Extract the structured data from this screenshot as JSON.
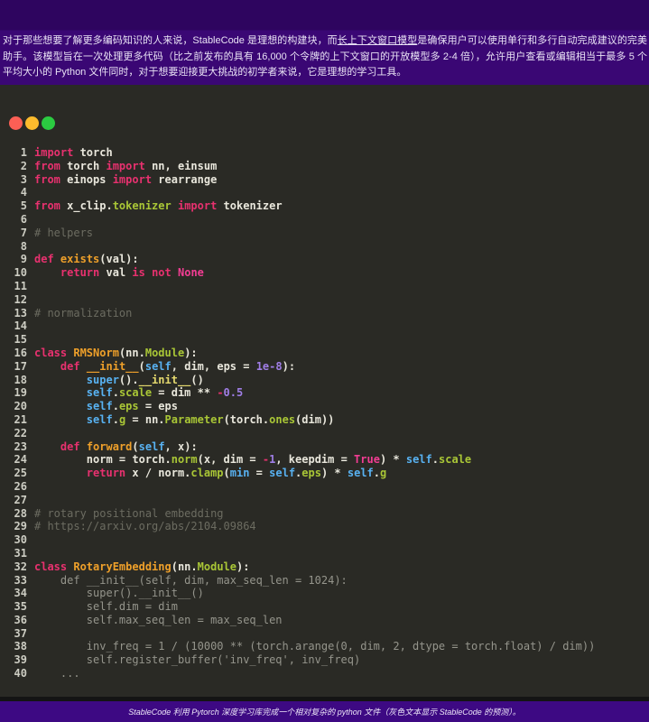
{
  "header": {
    "paragraph_before_link": "对于那些想要了解更多编码知识的人来说，StableCode 是理想的构建块，而",
    "link_text": "长上下文窗口模型",
    "paragraph_after_link": "是确保用户可以使用单行和多行自动完成建议的完美助手。该模型旨在一次处理更多代码（比之前发布的具有 16,000 个令牌的上下文窗口的开放模型多 2-4 倍），允许用户查看或编辑相当于最多 5 个平均大小的 Python 文件同时，对于想要迎接更大挑战的初学者来说，它是理想的学习工具。"
  },
  "window": {
    "traffic_lights": [
      {
        "name": "close-button",
        "color": "#fb5f55"
      },
      {
        "name": "minimize-button",
        "color": "#fcbb2d"
      },
      {
        "name": "zoom-button",
        "color": "#2bcb41"
      }
    ]
  },
  "colors": {
    "banner_purple": "#3a0774",
    "footer_purple": "#3d0983",
    "code_background": "#2a2a25",
    "keyword_pink": "#e8316f",
    "constant_magenta": "#f23d93",
    "function_orange": "#efa02a",
    "method_green": "#a9c636",
    "builtin_blue": "#58b2f2",
    "number_purple": "#a07ee6",
    "comment_gray": "#6c6c61",
    "prediction_gray": "#95958c",
    "plain_code": "#e9e7dc"
  },
  "code": {
    "lines": [
      {
        "num": "1",
        "tk": [
          [
            "k",
            "import"
          ],
          [
            "p",
            " torch"
          ]
        ]
      },
      {
        "num": "2",
        "tk": [
          [
            "k",
            "from"
          ],
          [
            "p",
            " torch "
          ],
          [
            "k",
            "import"
          ],
          [
            "p",
            " nn, einsum"
          ]
        ]
      },
      {
        "num": "3",
        "tk": [
          [
            "k",
            "from"
          ],
          [
            "p",
            " einops "
          ],
          [
            "k",
            "import"
          ],
          [
            "p",
            " rearrange"
          ]
        ]
      },
      {
        "num": "4",
        "tk": []
      },
      {
        "num": "5",
        "tk": [
          [
            "k",
            "from"
          ],
          [
            "p",
            " x_clip."
          ],
          [
            "g",
            "tokenizer"
          ],
          [
            "p",
            " "
          ],
          [
            "k",
            "import"
          ],
          [
            "p",
            " tokenizer"
          ]
        ]
      },
      {
        "num": "6",
        "tk": []
      },
      {
        "num": "7",
        "tk": [
          [
            "c",
            "# helpers"
          ]
        ]
      },
      {
        "num": "8",
        "tk": []
      },
      {
        "num": "9",
        "tk": [
          [
            "k",
            "def"
          ],
          [
            "p",
            " "
          ],
          [
            "f",
            "exists"
          ],
          [
            "p",
            "(val):"
          ]
        ]
      },
      {
        "num": "10",
        "tk": [
          [
            "p",
            "    "
          ],
          [
            "k",
            "return"
          ],
          [
            "p",
            " val "
          ],
          [
            "k",
            "is"
          ],
          [
            "p",
            " "
          ],
          [
            "k",
            "not"
          ],
          [
            "p",
            " "
          ],
          [
            "K",
            "None"
          ]
        ]
      },
      {
        "num": "11",
        "tk": []
      },
      {
        "num": "12",
        "tk": []
      },
      {
        "num": "13",
        "tk": [
          [
            "c",
            "# normalization"
          ]
        ]
      },
      {
        "num": "14",
        "tk": []
      },
      {
        "num": "15",
        "tk": []
      },
      {
        "num": "16",
        "tk": [
          [
            "k",
            "class"
          ],
          [
            "p",
            " "
          ],
          [
            "f",
            "RMSNorm"
          ],
          [
            "p",
            "(nn."
          ],
          [
            "g",
            "Module"
          ],
          [
            "p",
            "):"
          ]
        ]
      },
      {
        "num": "17",
        "tk": [
          [
            "p",
            "    "
          ],
          [
            "k",
            "def"
          ],
          [
            "p",
            " "
          ],
          [
            "f",
            "__init__"
          ],
          [
            "p",
            "("
          ],
          [
            "b",
            "self"
          ],
          [
            "p",
            ", dim, eps = "
          ],
          [
            "n",
            "1e-8"
          ],
          [
            "p",
            "):"
          ]
        ]
      },
      {
        "num": "18",
        "tk": [
          [
            "p",
            "        "
          ],
          [
            "b",
            "super"
          ],
          [
            "p",
            "()."
          ],
          [
            "y",
            "__init__"
          ],
          [
            "p",
            "()"
          ]
        ]
      },
      {
        "num": "19",
        "tk": [
          [
            "p",
            "        "
          ],
          [
            "b",
            "self"
          ],
          [
            "p",
            "."
          ],
          [
            "g",
            "scale"
          ],
          [
            "p",
            " = dim ** "
          ],
          [
            "o",
            "-"
          ],
          [
            "n",
            "0.5"
          ]
        ]
      },
      {
        "num": "20",
        "tk": [
          [
            "p",
            "        "
          ],
          [
            "b",
            "self"
          ],
          [
            "p",
            "."
          ],
          [
            "g",
            "eps"
          ],
          [
            "p",
            " = eps"
          ]
        ]
      },
      {
        "num": "21",
        "tk": [
          [
            "p",
            "        "
          ],
          [
            "b",
            "self"
          ],
          [
            "p",
            "."
          ],
          [
            "g",
            "g"
          ],
          [
            "p",
            " = nn."
          ],
          [
            "g",
            "Parameter"
          ],
          [
            "p",
            "(torch."
          ],
          [
            "g",
            "ones"
          ],
          [
            "p",
            "(dim))"
          ]
        ]
      },
      {
        "num": "22",
        "tk": []
      },
      {
        "num": "23",
        "tk": [
          [
            "p",
            "    "
          ],
          [
            "k",
            "def"
          ],
          [
            "p",
            " "
          ],
          [
            "f",
            "forward"
          ],
          [
            "p",
            "("
          ],
          [
            "b",
            "self"
          ],
          [
            "p",
            ", x):"
          ]
        ]
      },
      {
        "num": "24",
        "tk": [
          [
            "p",
            "        norm = torch."
          ],
          [
            "g",
            "norm"
          ],
          [
            "p",
            "(x, dim = "
          ],
          [
            "o",
            "-"
          ],
          [
            "n",
            "1"
          ],
          [
            "p",
            ", keepdim = "
          ],
          [
            "K",
            "True"
          ],
          [
            "p",
            ") * "
          ],
          [
            "b",
            "self"
          ],
          [
            "p",
            "."
          ],
          [
            "g",
            "scale"
          ]
        ]
      },
      {
        "num": "25",
        "tk": [
          [
            "p",
            "        "
          ],
          [
            "k",
            "return"
          ],
          [
            "p",
            " x / norm."
          ],
          [
            "g",
            "clamp"
          ],
          [
            "p",
            "("
          ],
          [
            "b",
            "min"
          ],
          [
            "p",
            " = "
          ],
          [
            "b",
            "self"
          ],
          [
            "p",
            "."
          ],
          [
            "g",
            "eps"
          ],
          [
            "p",
            ") * "
          ],
          [
            "b",
            "self"
          ],
          [
            "p",
            "."
          ],
          [
            "g",
            "g"
          ]
        ]
      },
      {
        "num": "26",
        "tk": []
      },
      {
        "num": "27",
        "tk": []
      },
      {
        "num": "28",
        "tk": [
          [
            "c",
            "# rotary positional embedding"
          ]
        ]
      },
      {
        "num": "29",
        "tk": [
          [
            "c",
            "# https://arxiv.org/abs/2104.09864"
          ]
        ]
      },
      {
        "num": "30",
        "tk": []
      },
      {
        "num": "31",
        "tk": []
      },
      {
        "num": "32",
        "tk": [
          [
            "k",
            "class"
          ],
          [
            "p",
            " "
          ],
          [
            "f",
            "RotaryEmbedding"
          ],
          [
            "p",
            "(nn."
          ],
          [
            "g",
            "Module"
          ],
          [
            "p",
            "):"
          ]
        ]
      },
      {
        "num": "33",
        "tk": [
          [
            "d",
            "    def __init__(self, dim, max_seq_len = 1024):"
          ]
        ]
      },
      {
        "num": "34",
        "tk": [
          [
            "d",
            "        super().__init__()"
          ]
        ]
      },
      {
        "num": "35",
        "tk": [
          [
            "d",
            "        self.dim = dim"
          ]
        ]
      },
      {
        "num": "36",
        "tk": [
          [
            "d",
            "        self.max_seq_len = max_seq_len"
          ]
        ]
      },
      {
        "num": "37",
        "tk": []
      },
      {
        "num": "38",
        "tk": [
          [
            "d",
            "        inv_freq = 1 / (10000 ** (torch.arange(0, dim, 2, dtype = torch.float) / dim))"
          ]
        ]
      },
      {
        "num": "39",
        "tk": [
          [
            "d",
            "        self.register_buffer('inv_freq', inv_freq)"
          ]
        ]
      },
      {
        "num": "40",
        "tk": [
          [
            "d",
            "    ..."
          ]
        ]
      }
    ]
  },
  "footer": {
    "caption": "StableCode 利用 Pytorch 深度学习库完成一个相对复杂的 python 文件（灰色文本显示 StableCode 的预测）。"
  }
}
